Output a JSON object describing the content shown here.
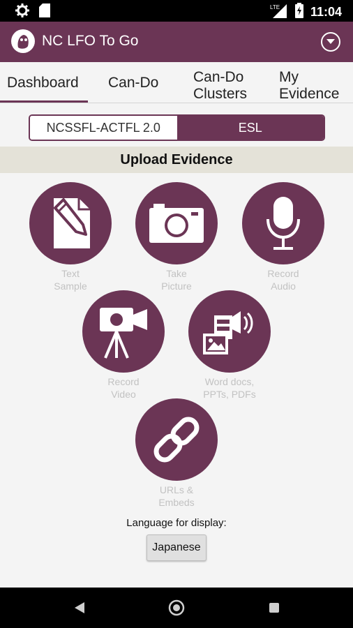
{
  "status_bar": {
    "time": "11:04",
    "network": "LTE",
    "icons": [
      "settings-icon",
      "sd-card-icon",
      "signal-icon",
      "battery-icon"
    ]
  },
  "app_bar": {
    "title": "NC LFO To Go",
    "logo_icon": "owl-logo",
    "menu_icon": "chevron-down-circle-icon",
    "color": "#6b3555"
  },
  "tabs": [
    {
      "label": "Dashboard",
      "active": true
    },
    {
      "label": "Can-Do",
      "active": false
    },
    {
      "label": "Can-Do Clusters",
      "active": false
    },
    {
      "label": "My Evidence",
      "active": false
    }
  ],
  "segmented": {
    "options": [
      "NCSSFL-ACTFL 2.0",
      "ESL"
    ],
    "selected": "ESL"
  },
  "section": {
    "title": "Upload Evidence"
  },
  "upload_options": [
    {
      "label": "Text\nSample",
      "icon": "text-sample-icon"
    },
    {
      "label": "Take\nPicture",
      "icon": "camera-icon"
    },
    {
      "label": "Record\nAudio",
      "icon": "microphone-icon"
    },
    {
      "label": "Record\nVideo",
      "icon": "video-camera-icon"
    },
    {
      "label": "Word docs,\nPPTs, PDFs",
      "icon": "documents-icon"
    },
    {
      "label": "URLs &\nEmbeds",
      "icon": "link-icon"
    }
  ],
  "language": {
    "label": "Language for display:",
    "button": "Japanese"
  },
  "nav_bar": {
    "icons": [
      "back-icon",
      "home-icon",
      "recents-icon"
    ]
  },
  "colors": {
    "primary": "#6b3555",
    "section_bg": "#e4e2d8",
    "label_gray": "#c2c2c2"
  }
}
